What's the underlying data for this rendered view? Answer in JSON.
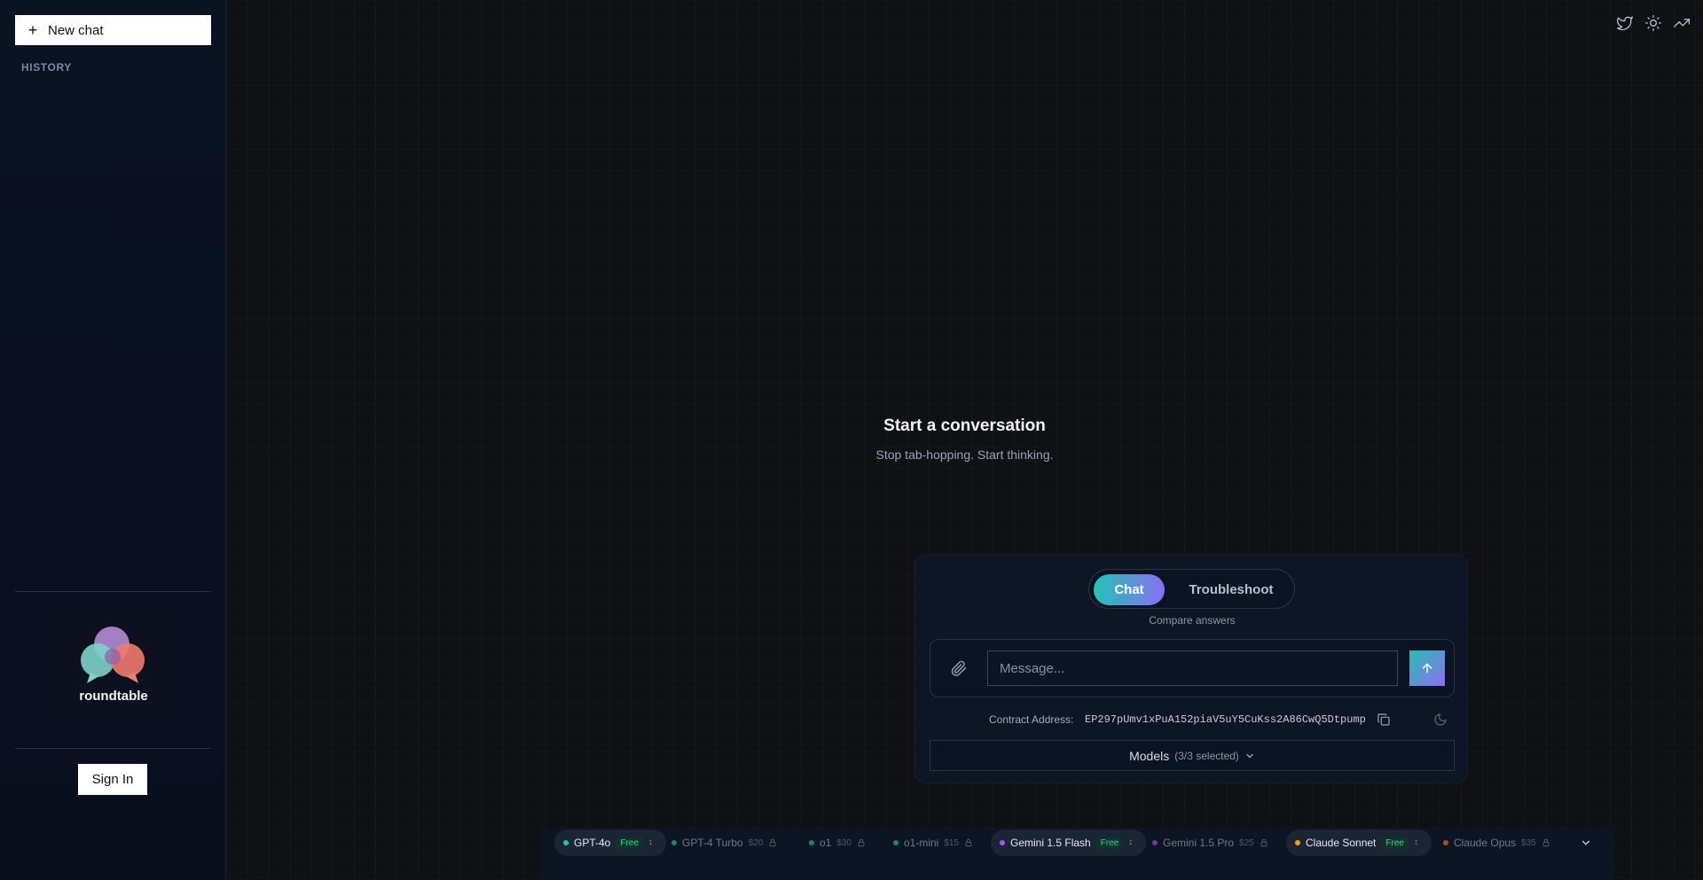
{
  "sidebar": {
    "new_chat_label": "New chat",
    "history_label": "HISTORY",
    "logo_text": "roundtable",
    "sign_in_label": "Sign In"
  },
  "header": {
    "icons": [
      "twitter-icon",
      "sun-icon",
      "trending-icon"
    ]
  },
  "hero": {
    "title": "Start a conversation",
    "subtitle": "Stop tab-hopping. Start thinking."
  },
  "composer": {
    "modes": [
      "Chat",
      "Troubleshoot"
    ],
    "active_mode": "Chat",
    "compare_label": "Compare answers",
    "message_placeholder": "Message...",
    "contract_label": "Contract Address:",
    "contract_value": "EP297pUmv1xPuA152piaV5uY5CuKss2A86CwQ5Dtpump",
    "models_label": "Models",
    "models_count": "(3/3 selected)"
  },
  "models": [
    {
      "name": "GPT-4o",
      "tag": "Free",
      "selected": true,
      "dot": "#22c3b6"
    },
    {
      "name": "GPT-4 Turbo",
      "tag": "$20",
      "selected": false,
      "dot": "#1f7f78"
    },
    {
      "name": "o1",
      "tag": "$30",
      "selected": false,
      "dot": "#1f7f78"
    },
    {
      "name": "o1-mini",
      "tag": "$15",
      "selected": false,
      "dot": "#1f7f78"
    },
    {
      "name": "Gemini 1.5 Flash",
      "tag": "Free",
      "selected": true,
      "dot": "#a855f7"
    },
    {
      "name": "Gemini 1.5 Pro",
      "tag": "$25",
      "selected": false,
      "dot": "#6b3fa0"
    },
    {
      "name": "Claude Sonnet",
      "tag": "Free",
      "selected": true,
      "dot": "#f59e0b"
    },
    {
      "name": "Claude Opus",
      "tag": "$35",
      "selected": false,
      "dot": "#a5531c"
    }
  ],
  "colors": {
    "accent_start": "#22c3b6",
    "accent_end": "#8b6ff3",
    "free_badge": "#2fd3a4"
  }
}
